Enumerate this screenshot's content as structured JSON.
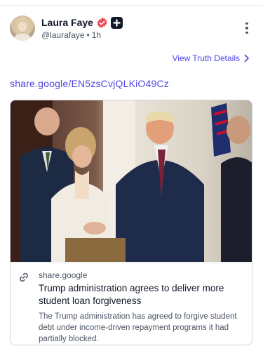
{
  "post": {
    "author": {
      "display_name": "Laura Faye",
      "handle": "@laurafaye",
      "time_ago": "1h",
      "separator": "•",
      "avatar_icon": "profile-photo",
      "badges": [
        "verified-badge-icon",
        "plus-badge-icon"
      ]
    },
    "more_icon": "vertical-ellipsis-icon",
    "details_link": "View Truth Details",
    "share_url": "share.google/EN5zsCvjQLKiO49Cz",
    "link_card": {
      "image_alt": "Trump shaking hands with a woman at a White House event",
      "domain": "share.google",
      "title": "Trump administration agrees to deliver more student loan forgiveness",
      "description": "The Trump administration has agreed to forgive student debt under income-driven repayment programs it had partially blocked.",
      "icon": "link-icon"
    }
  },
  "colors": {
    "accent": "#4f46e5",
    "verified": "#f04b5a",
    "text_primary": "#111827",
    "text_secondary": "#4b5563",
    "border": "#d1d5db"
  }
}
